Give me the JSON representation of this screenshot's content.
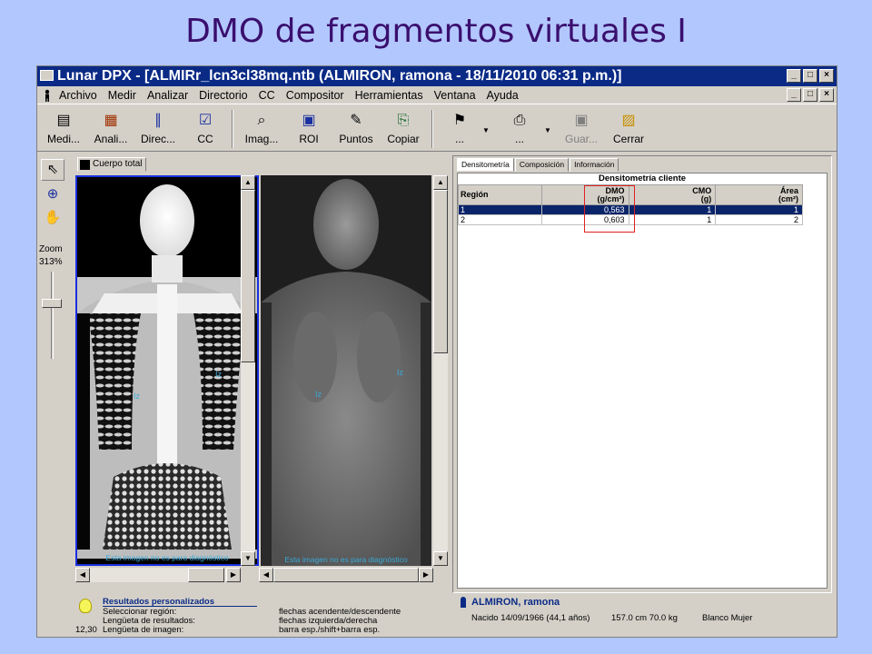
{
  "slide_title": "DMO de fragmentos virtuales I",
  "window": {
    "title": "Lunar DPX - [ALMIRr_lcn3cl38mq.ntb (ALMIRON, ramona - 18/11/2010 06:31 p.m.)]",
    "controls": [
      "_",
      "□",
      "×"
    ]
  },
  "menu": [
    "Archivo",
    "Medir",
    "Analizar",
    "Directorio",
    "CC",
    "Compositor",
    "Herramientas",
    "Ventana",
    "Ayuda"
  ],
  "toolbar": [
    {
      "label": "Medi...",
      "icon": "scanner-icon",
      "glyph": "▤"
    },
    {
      "label": "Anali...",
      "icon": "analyze-icon",
      "glyph": "▦"
    },
    {
      "label": "Direc...",
      "icon": "directory-icon",
      "glyph": "∥"
    },
    {
      "label": "CC",
      "icon": "qc-checkbox-icon",
      "glyph": "☑"
    },
    {
      "label": "Imag...",
      "icon": "image-magnifier-icon",
      "glyph": "⌕"
    },
    {
      "label": "ROI",
      "icon": "roi-icon",
      "glyph": "▣"
    },
    {
      "label": "Puntos",
      "icon": "brush-icon",
      "glyph": "✎"
    },
    {
      "label": "Copiar",
      "icon": "copy-icon",
      "glyph": "⎘"
    },
    {
      "label": "...",
      "icon": "flag-icon",
      "glyph": "⚑"
    },
    {
      "label": "...",
      "icon": "printer-icon",
      "glyph": "⎙"
    },
    {
      "label": "Guar...",
      "icon": "save-icon",
      "glyph": "▣"
    },
    {
      "label": "Cerrar",
      "icon": "close-folder-icon",
      "glyph": "▨"
    }
  ],
  "left_tools": {
    "zoom_label": "Zoom",
    "zoom_value": "313%"
  },
  "image_tab": "Cuerpo total",
  "scan_note": "Esta imagen no es para diagnóstico",
  "roi_labels": {
    "left": "Iz",
    "right": "Iz"
  },
  "data_tabs": [
    "Densitometría",
    "Composición",
    "Información"
  ],
  "table": {
    "caption": "Densitometría cliente",
    "headers": [
      {
        "l1": "Región",
        "l2": ""
      },
      {
        "l1": "DMO",
        "l2": "(g/cm²)"
      },
      {
        "l1": "CMO",
        "l2": "(g)"
      },
      {
        "l1": "Área",
        "l2": "(cm²)"
      }
    ],
    "rows": [
      [
        "1",
        "0,563",
        "1",
        "1"
      ],
      [
        "2",
        "0,603",
        "1",
        "2"
      ]
    ],
    "selected_row": 0
  },
  "status": {
    "heading": "Resultados personalizados",
    "left_lines": [
      "Seleccionar región:",
      "Lengüeta de resultados:",
      "Lengüeta de imagen:"
    ],
    "mid_lines": [
      "flechas acendente/descendente",
      "flechas izquierda/derecha",
      "barra esp./shift+barra esp."
    ],
    "counter": "12,30",
    "patient_name": "ALMIRON, ramona",
    "patient_info": "Nacido 14/09/1966 (44,1 años)",
    "patient_measures": "157.0 cm 70.0 kg",
    "patient_ref": "Blanco Mujer"
  }
}
